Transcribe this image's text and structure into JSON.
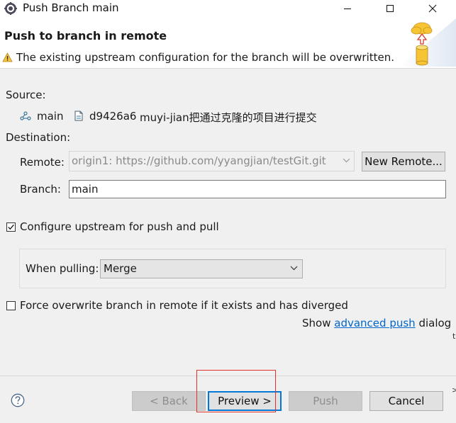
{
  "window": {
    "title": "Push Branch main"
  },
  "header": {
    "title": "Push to branch in remote",
    "warning": "The existing upstream configuration for the branch will be overwritten."
  },
  "source": {
    "label": "Source:",
    "branch": "main",
    "commit_id": "d9426a6",
    "commit_message": "muyi-jian把通过克隆的项目进行提交"
  },
  "destination": {
    "label": "Destination:",
    "remote_label": "Remote:",
    "remote_value": "origin1: https://github.com/yyangjian/testGit.git",
    "new_remote_label": "New Remote...",
    "branch_label": "Branch:",
    "branch_value": "main"
  },
  "upstream": {
    "configure_label": "Configure upstream for push and pull",
    "configure_checked": true,
    "when_pulling_label": "When pulling:",
    "when_pulling_value": "Merge"
  },
  "force": {
    "label": "Force overwrite branch in remote if it exists and has diverged",
    "checked": false
  },
  "advanced": {
    "prefix": "Show",
    "link": "advanced push",
    "suffix": "dialog"
  },
  "buttons": {
    "back": "< Back",
    "preview": "Preview >",
    "push": "Push",
    "cancel": "Cancel"
  },
  "colors": {
    "link": "#0066cc",
    "highlight_box": "#e0302a",
    "focus_border": "#0078d7"
  }
}
